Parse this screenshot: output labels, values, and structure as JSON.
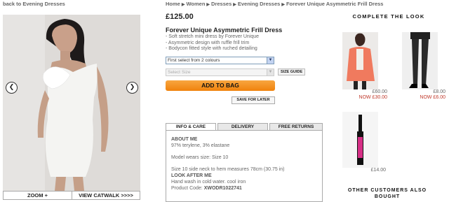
{
  "nav": {
    "back_link": "back to Evening Dresses"
  },
  "breadcrumb": [
    "Home",
    "Women",
    "Dresses",
    "Evening Dresses",
    "Forever Unique Asymmetric Frill Dress"
  ],
  "product": {
    "price": "£125.00",
    "title": "Forever Unique Asymmetric Frill Dress",
    "features": [
      "- Soft stretch mini dress by Forever Unique",
      "- Asymmetric design with ruffle frill trim",
      "- Bodycon fitted style with ruched detailing"
    ],
    "colour_select": "First select from 2 colours",
    "size_select": "Select Size",
    "size_guide": "SIZE GUIDE",
    "add_to_bag": "ADD TO BAG",
    "save_later": "SAVE FOR LATER"
  },
  "gallery": {
    "zoom": "ZOOM +",
    "catwalk": "VIEW CATWALK >>>>",
    "prev_icon": "chevron-left-icon",
    "next_icon": "chevron-right-icon"
  },
  "tabs": [
    "INFO & CARE",
    "DELIVERY",
    "FREE RETURNS"
  ],
  "info": {
    "about_heading": "ABOUT ME",
    "composition": "97% terylene, 3% elastane",
    "model_size": "Model wears size: Size 10",
    "measure": "Size 10 side neck to hem measures 78cm (30.75 in)",
    "care_heading": "LOOK AFTER ME",
    "care": "Hand wash in cold water. cool iron",
    "code_label": "Product Code:",
    "code": "XWODR1022741"
  },
  "complete_look": {
    "heading": "COMPLETE THE LOOK",
    "items": [
      {
        "was": "£60.00",
        "now": "NOW £30.00"
      },
      {
        "was": "£8.00",
        "now": "NOW £6.00"
      },
      {
        "price": "£14.00"
      }
    ]
  },
  "other_customers": "OTHER CUSTOMERS ALSO BOUGHT"
}
